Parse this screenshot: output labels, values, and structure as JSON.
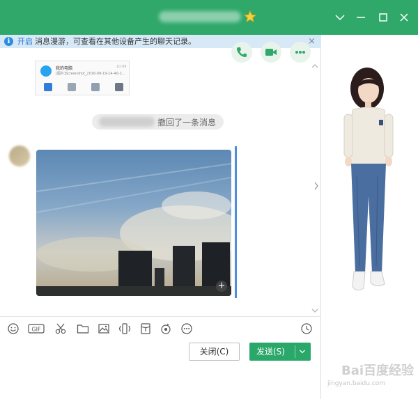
{
  "notice": {
    "link": "开启",
    "text": "消息漫游，可查看在其他设备产生的聊天记录。",
    "close": "×"
  },
  "preview_card": {
    "title": "我的电脑",
    "subtitle": "[图片]Screenshot_2016-08-19-14-40-2...",
    "time": "10:09"
  },
  "recall_message": {
    "text": "撤回了一条消息"
  },
  "buttons": {
    "close_label": "关闭(C)",
    "send_label": "发送(S)"
  },
  "toolbar": {
    "gif_label": "GIF"
  },
  "watermark": {
    "brand": "Bai百度经验",
    "url": "jingyan.baidu.com"
  },
  "colors": {
    "titlebar": "#2fa86a",
    "notice_bg": "#d7e8f7",
    "send_button": "#2aa86a",
    "selection_bar": "#4b8fd8"
  },
  "icons": {
    "window": [
      "chevron-down-icon",
      "minimize-icon",
      "maximize-icon",
      "close-icon"
    ],
    "actions": [
      "phone-icon",
      "video-icon",
      "more-icon"
    ],
    "toolbar": [
      "emoji-icon",
      "gif-icon",
      "scissors-icon",
      "folder-icon",
      "image-icon",
      "shake-icon",
      "red-packet-icon",
      "music-icon",
      "more-options-icon",
      "history-icon"
    ]
  }
}
